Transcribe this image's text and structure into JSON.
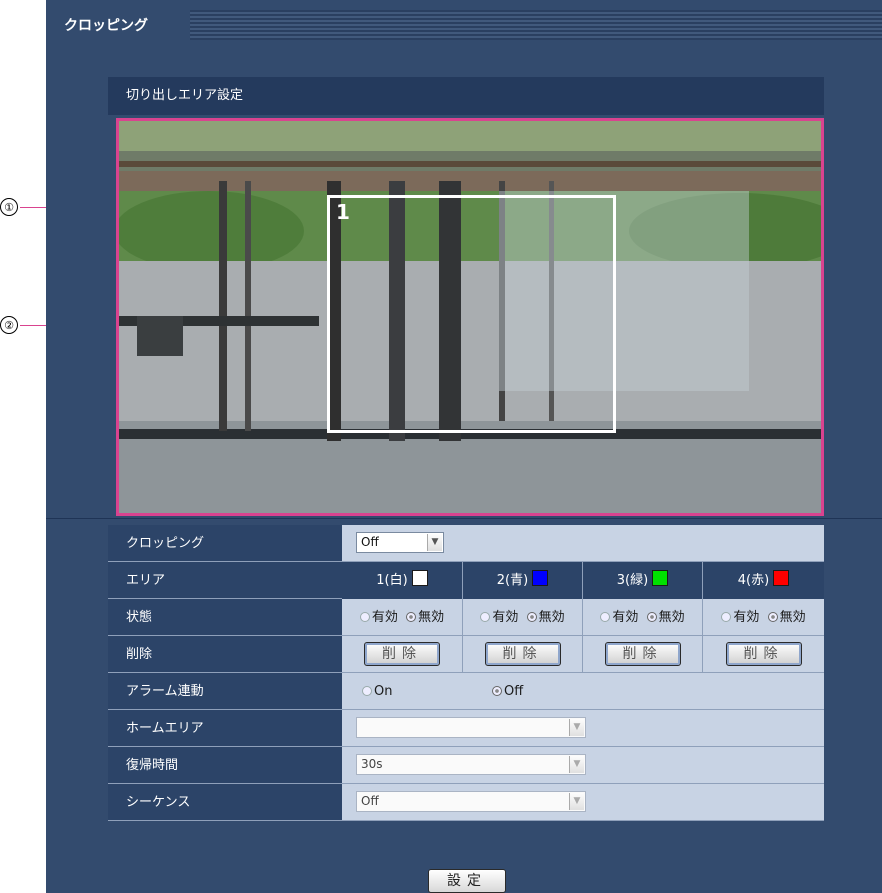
{
  "tab": {
    "label": "クロッピング"
  },
  "section": {
    "title": "切り出しエリア設定"
  },
  "callouts": [
    "①",
    "②"
  ],
  "preview": {
    "crop_area_number": "1",
    "crop_area_color": "#ffffff"
  },
  "form": {
    "cropping": {
      "label": "クロッピング",
      "value": "Off"
    },
    "area": {
      "label": "エリア",
      "items": [
        {
          "label": "1(白)",
          "color": "#ffffff"
        },
        {
          "label": "2(青)",
          "color": "#0000ff"
        },
        {
          "label": "3(緑)",
          "color": "#00e000"
        },
        {
          "label": "4(赤)",
          "color": "#ff0000"
        }
      ]
    },
    "status": {
      "label": "状態",
      "on": "有効",
      "off": "無効"
    },
    "delete": {
      "label": "削除",
      "button": "削除"
    },
    "alarm": {
      "label": "アラーム連動",
      "on": "On",
      "off": "Off"
    },
    "home_area": {
      "label": "ホームエリア",
      "value": ""
    },
    "return_time": {
      "label": "復帰時間",
      "value": "30s"
    },
    "sequence": {
      "label": "シーケンス",
      "value": "Off"
    }
  },
  "set_button": "設定",
  "colors": {
    "panel_bg": "#334b6e",
    "highlight": "#d9438f",
    "value_bg": "#c8d3e4"
  }
}
